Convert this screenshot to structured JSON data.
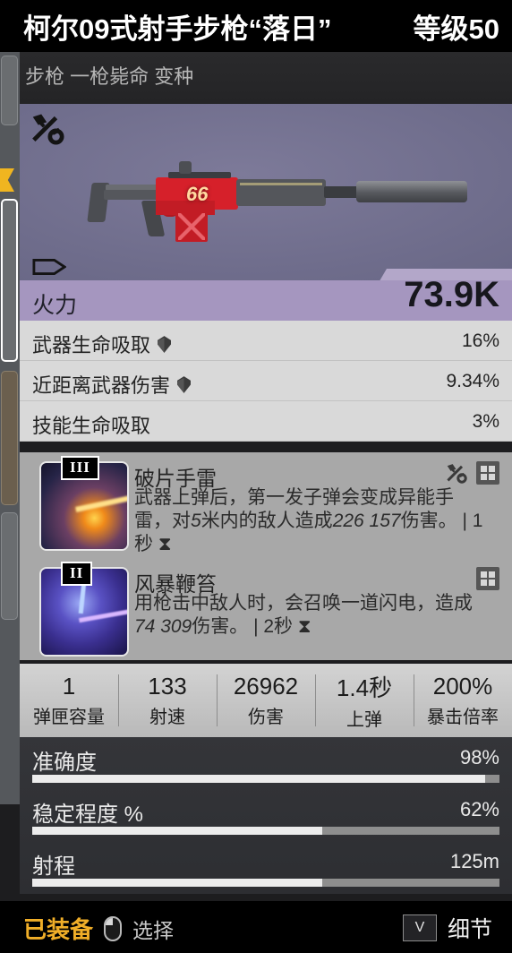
{
  "header": {
    "title": "柯尔09式射手步枪“落日”",
    "level": "等级50",
    "subtitle": "步枪 一枪毙命 变种"
  },
  "preview": {
    "mod_icon": "wrench-screwdriver-icon",
    "tag_icon": "bullet-tag-icon",
    "weapon_marking": "66"
  },
  "firepower": {
    "label": "火力",
    "value": "73.9K",
    "accent": "#a596bf"
  },
  "attributes": [
    {
      "name": "武器生命吸取",
      "value": "16%",
      "core": true
    },
    {
      "name": "近距离武器伤害",
      "value": "9.34%",
      "core": true
    },
    {
      "name": "技能生命吸取",
      "value": "3%",
      "core": false
    }
  ],
  "mods": [
    {
      "rank": "III",
      "title": "破片手雷",
      "desc_pre": "武器上弹后，第一发子弹会变成异能手雷，对",
      "desc_num1": "5",
      "desc_mid": "米内的敌人造成",
      "desc_num2": "226 157",
      "desc_post": "伤害。",
      "duration": "| 1秒",
      "icons": [
        "wrench-screwdriver-icon",
        "grid-icon"
      ]
    },
    {
      "rank": "II",
      "title": "风暴鞭笞",
      "desc_pre": "用枪击中敌人时，会召唤一道闪电，造成",
      "desc_num1": "",
      "desc_mid": "",
      "desc_num2": "74 309",
      "desc_post": "伤害。",
      "duration": "| 2秒",
      "icons": [
        "grid-icon"
      ]
    }
  ],
  "stats": [
    {
      "value": "1",
      "label": "弹匣容量"
    },
    {
      "value": "133",
      "label": "射速"
    },
    {
      "value": "26962",
      "label": "伤害"
    },
    {
      "value": "1.4秒",
      "label": "上弹"
    },
    {
      "value": "200%",
      "label": "暴击倍率"
    }
  ],
  "bars": [
    {
      "label": "准确度",
      "value": "98%",
      "fill": 97
    },
    {
      "label": "稳定程度 %",
      "value": "62%",
      "fill": 62
    },
    {
      "label": "射程",
      "value": "125m",
      "fill": 62
    }
  ],
  "footer": {
    "equipped": "已装备",
    "select": "选择",
    "detail_key": "V",
    "detail": "细节"
  }
}
